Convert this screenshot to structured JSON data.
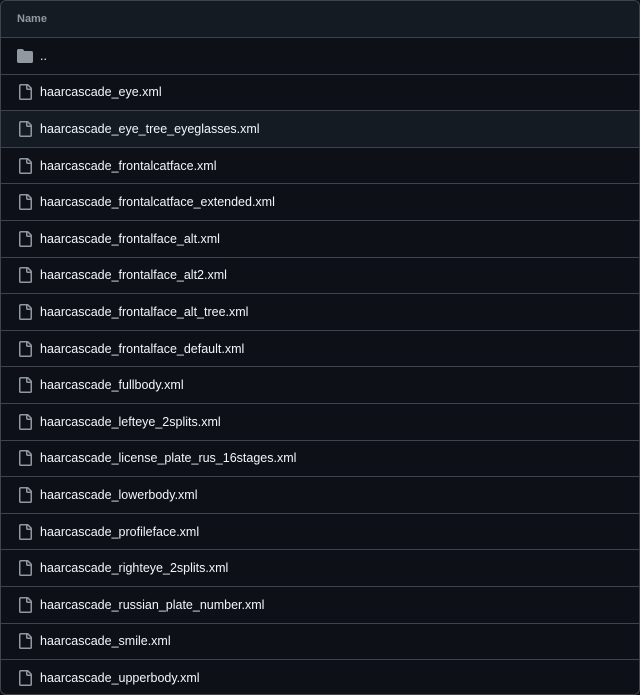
{
  "header": {
    "name_label": "Name"
  },
  "colors": {
    "background": "#0d1117",
    "border": "#3d444d",
    "header_bg": "#151b23",
    "text": "#f0f6fc",
    "muted": "#9198a1",
    "icon": "#9198a1"
  },
  "parent_dir": {
    "label": "..",
    "icon": "folder-icon"
  },
  "files": [
    {
      "name": "haarcascade_eye.xml",
      "icon": "file-icon"
    },
    {
      "name": "haarcascade_eye_tree_eyeglasses.xml",
      "icon": "file-icon"
    },
    {
      "name": "haarcascade_frontalcatface.xml",
      "icon": "file-icon"
    },
    {
      "name": "haarcascade_frontalcatface_extended.xml",
      "icon": "file-icon"
    },
    {
      "name": "haarcascade_frontalface_alt.xml",
      "icon": "file-icon"
    },
    {
      "name": "haarcascade_frontalface_alt2.xml",
      "icon": "file-icon"
    },
    {
      "name": "haarcascade_frontalface_alt_tree.xml",
      "icon": "file-icon"
    },
    {
      "name": "haarcascade_frontalface_default.xml",
      "icon": "file-icon"
    },
    {
      "name": "haarcascade_fullbody.xml",
      "icon": "file-icon"
    },
    {
      "name": "haarcascade_lefteye_2splits.xml",
      "icon": "file-icon"
    },
    {
      "name": "haarcascade_license_plate_rus_16stages.xml",
      "icon": "file-icon"
    },
    {
      "name": "haarcascade_lowerbody.xml",
      "icon": "file-icon"
    },
    {
      "name": "haarcascade_profileface.xml",
      "icon": "file-icon"
    },
    {
      "name": "haarcascade_righteye_2splits.xml",
      "icon": "file-icon"
    },
    {
      "name": "haarcascade_russian_plate_number.xml",
      "icon": "file-icon"
    },
    {
      "name": "haarcascade_smile.xml",
      "icon": "file-icon"
    },
    {
      "name": "haarcascade_upperbody.xml",
      "icon": "file-icon"
    }
  ]
}
